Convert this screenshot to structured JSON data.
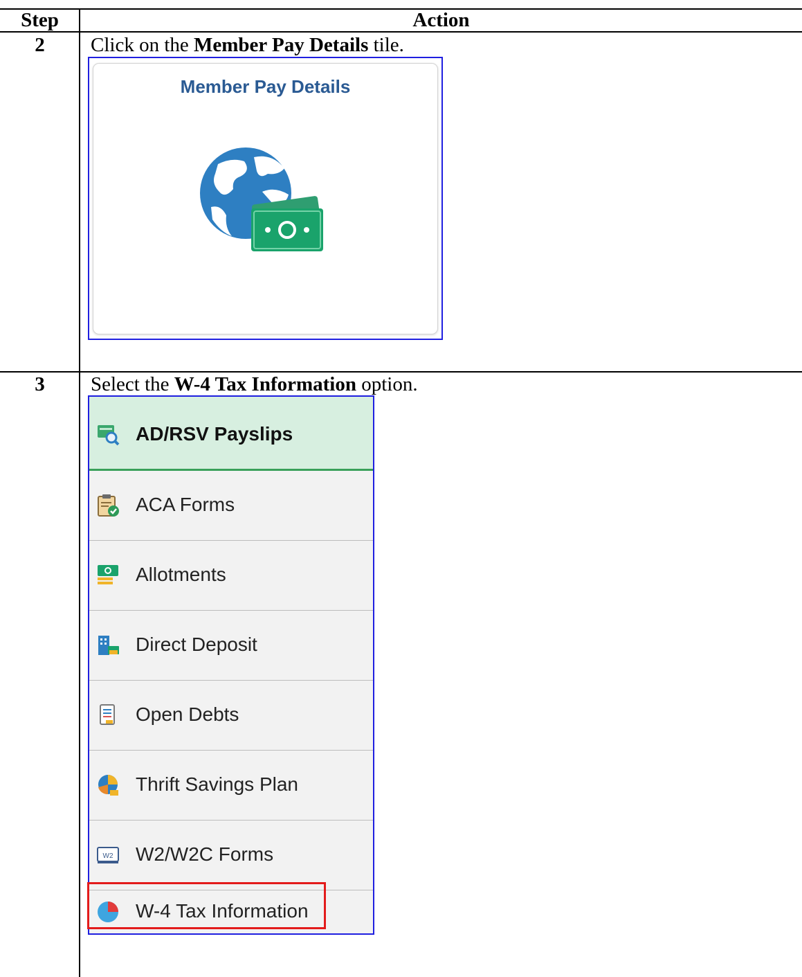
{
  "table": {
    "header": {
      "step": "Step",
      "action": "Action"
    },
    "rows": [
      {
        "step": "2",
        "instruction": {
          "prefix": "Click on the ",
          "bold": "Member Pay Details",
          "suffix": " tile."
        },
        "tile": {
          "title": "Member Pay Details",
          "icon": "globe-money-icon"
        }
      },
      {
        "step": "3",
        "instruction": {
          "prefix": "Select the ",
          "bold": "W-4 Tax Information",
          "suffix": " option."
        },
        "menu": [
          {
            "label": "AD/RSV Payslips",
            "icon": "payslip-search-icon",
            "active": true
          },
          {
            "label": "ACA Forms",
            "icon": "clipboard-check-icon"
          },
          {
            "label": "Allotments",
            "icon": "money-stack-icon"
          },
          {
            "label": "Direct Deposit",
            "icon": "bank-building-icon"
          },
          {
            "label": "Open Debts",
            "icon": "document-list-icon"
          },
          {
            "label": "Thrift Savings Plan",
            "icon": "savings-globe-icon"
          },
          {
            "label": "W2/W2C Forms",
            "icon": "w2-form-icon"
          },
          {
            "label": "W-4 Tax Information",
            "icon": "pie-chart-icon",
            "highlighted": true
          }
        ]
      }
    ]
  },
  "colors": {
    "tile_title": "#2a5a93",
    "frame_border": "#1f1fe0",
    "highlight": "#e31b1b",
    "active_bg": "#d7efe0"
  }
}
